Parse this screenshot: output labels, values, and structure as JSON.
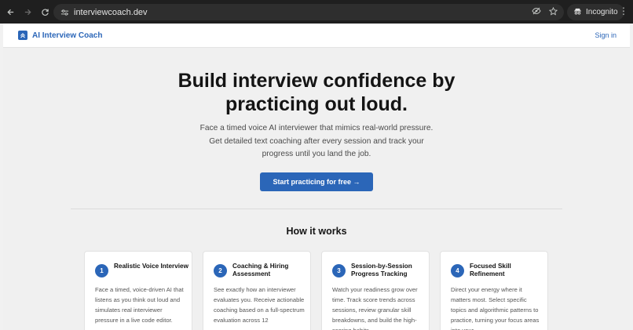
{
  "browser": {
    "url": "interviewcoach.dev",
    "profile_label": "Incognito",
    "icons": [
      "back-arrow-icon",
      "forward-arrow-icon",
      "reload-icon",
      "site-settings-icon",
      "eye-off-icon",
      "star-icon",
      "incognito-icon",
      "kebab-menu-icon"
    ]
  },
  "header": {
    "brand": "AI Interview Coach",
    "sign_in": "Sign in"
  },
  "hero": {
    "title_line1": "Build interview confidence by",
    "title_line2": "practicing out loud.",
    "subtitle": "Face a timed voice AI interviewer that mimics real-world pressure. Get detailed text coaching after every session and track your progress until you land the job.",
    "cta": "Start practicing for free →"
  },
  "how_it_works": {
    "title": "How it works",
    "steps": [
      {
        "number": "1",
        "title": "Realistic Voice Interview",
        "description": "Face a timed, voice-driven AI that listens as you think out loud and simulates real interviewer pressure in a live code editor."
      },
      {
        "number": "2",
        "title": "Coaching & Hiring Assessment",
        "description": "See exactly how an interviewer evaluates you. Receive actionable coaching based on a full-spectrum evaluation across 12"
      },
      {
        "number": "3",
        "title": "Session-by-Session Progress Tracking",
        "description": "Watch your readiness grow over time. Track score trends across sessions, review granular skill breakdowns, and build the high-scoring habits"
      },
      {
        "number": "4",
        "title": "Focused Skill Refinement",
        "description": "Direct your energy where it matters most. Select specific topics and algorithmic patterns to practice, turning your focus areas into your"
      }
    ]
  },
  "colors": {
    "brand": "#2b66b8",
    "chrome_bg": "#1f1f1f",
    "page_bg": "#f0f0f0"
  }
}
